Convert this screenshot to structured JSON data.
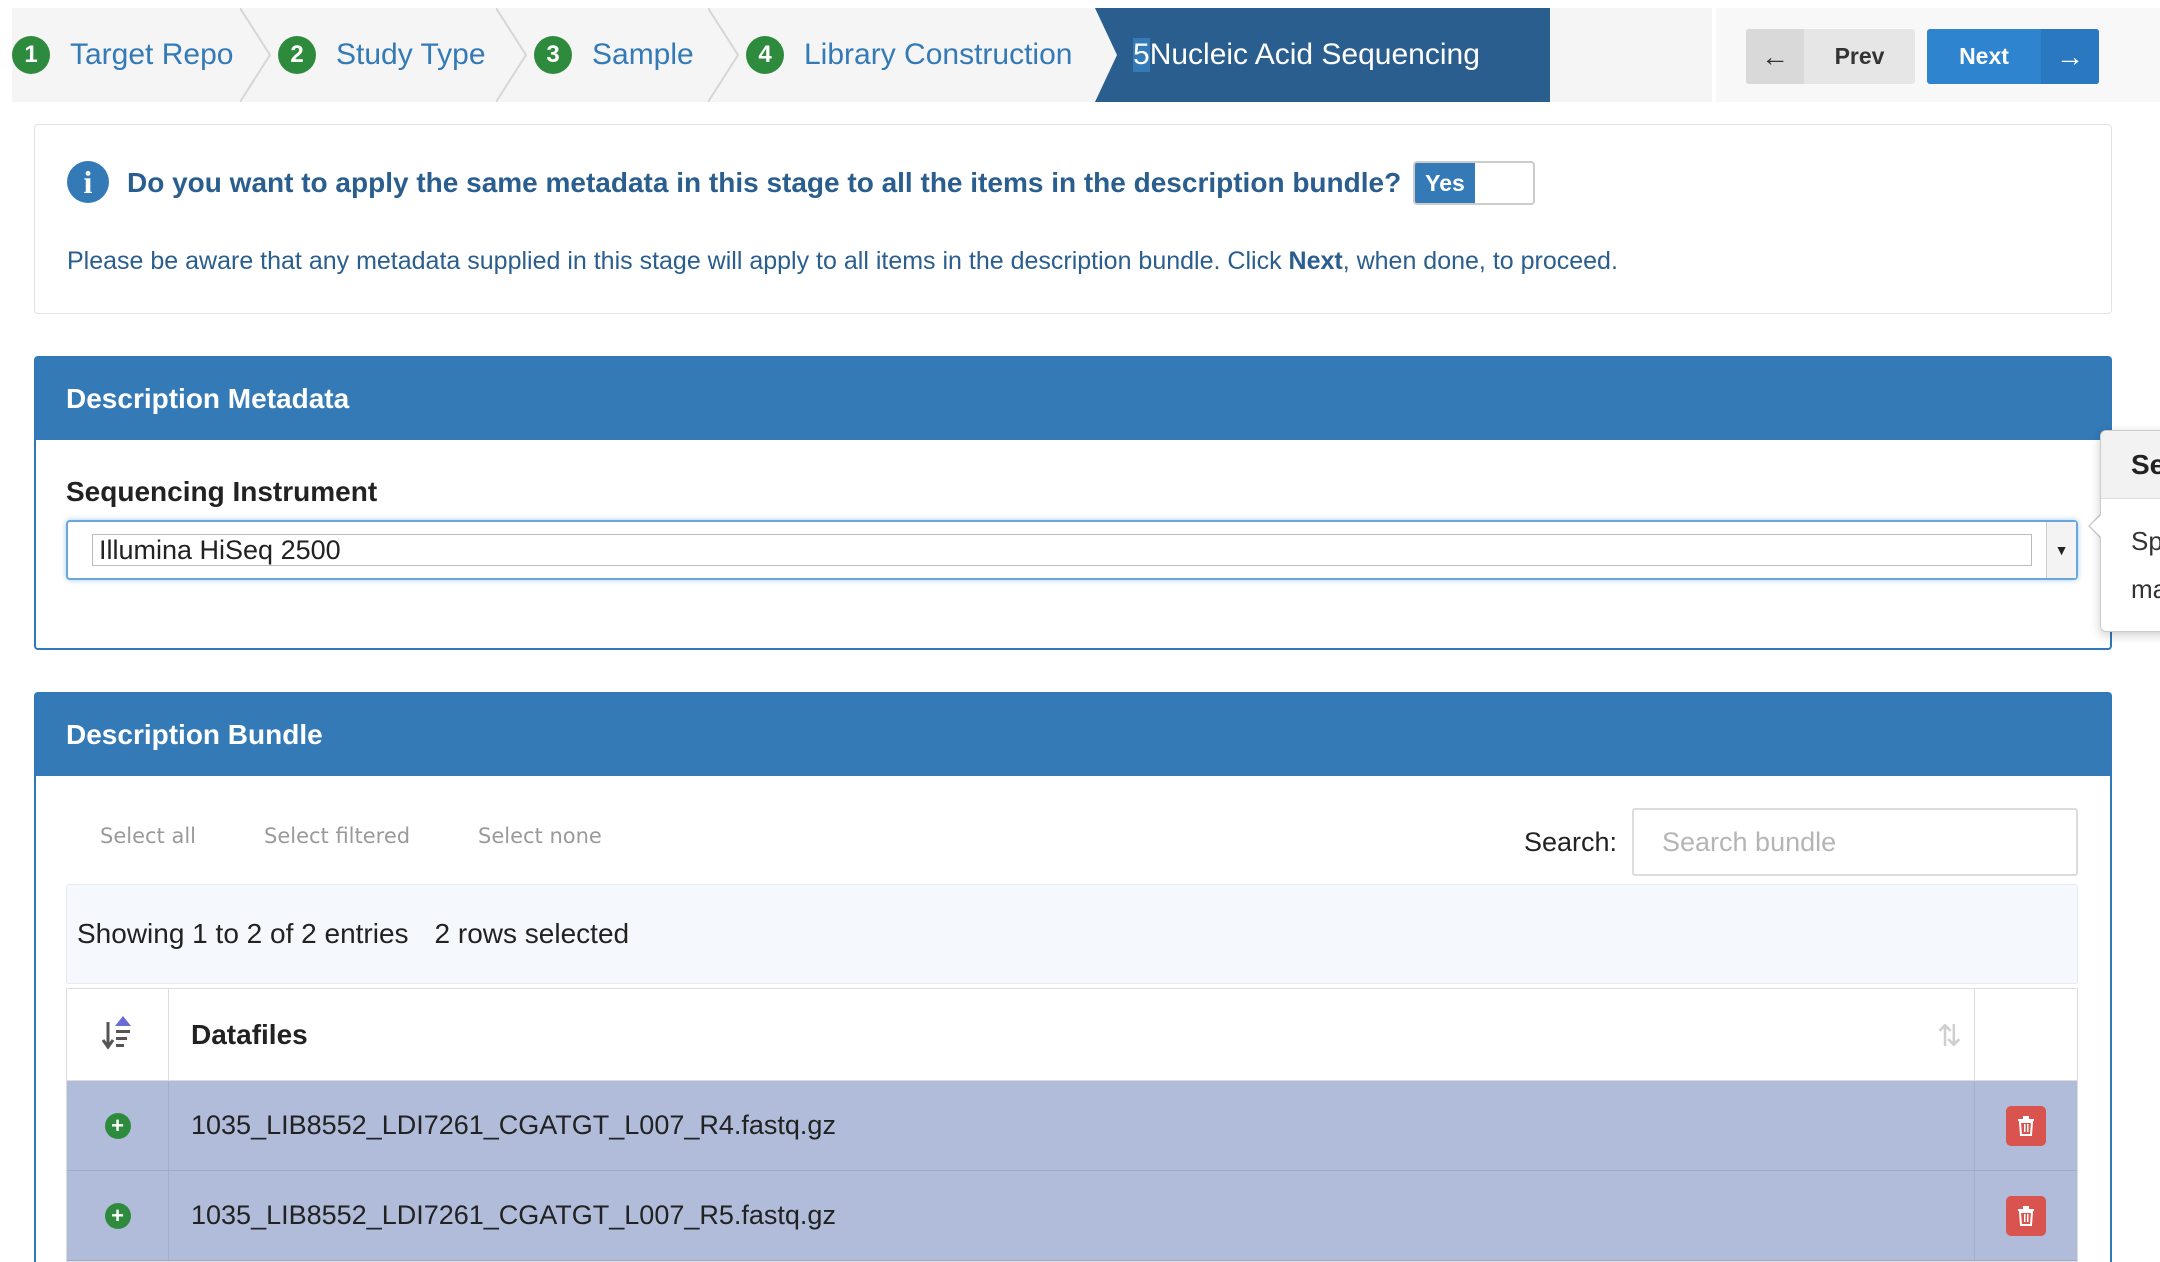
{
  "wizard": {
    "steps": [
      {
        "num": "1",
        "label": "Target Repo"
      },
      {
        "num": "2",
        "label": "Study Type"
      },
      {
        "num": "3",
        "label": "Sample"
      },
      {
        "num": "4",
        "label": "Library Construction"
      },
      {
        "num": "5",
        "label": "Nucleic Acid Sequencing",
        "active": true
      }
    ],
    "prev_label": "Prev",
    "next_label": "Next"
  },
  "info": {
    "question": "Do you want to apply the same metadata in this stage to all the items in the description bundle?",
    "toggle_label": "Yes",
    "note_prefix": "Please be aware that any metadata supplied in this stage will apply to all items in the description bundle. Click ",
    "note_bold": "Next",
    "note_suffix": ", when done, to proceed."
  },
  "metadata_panel": {
    "title": "Description Metadata",
    "field_label": "Sequencing Instrument",
    "field_value": "Illumina HiSeq 2500"
  },
  "popover": {
    "title": "Se",
    "lines": [
      "Sp",
      "ma"
    ]
  },
  "bundle_panel": {
    "title": "Description Bundle",
    "select_all": "Select all",
    "select_filtered": "Select filtered",
    "select_none": "Select none",
    "search_label": "Search:",
    "search_placeholder": "Search bundle",
    "showing": "Showing 1 to 2 of 2 entries",
    "selected": "2 rows selected",
    "column_header": "Datafiles",
    "rows": [
      "1035_LIB8552_LDI7261_CGATGT_L007_R4.fastq.gz",
      "1035_LIB8552_LDI7261_CGATGT_L007_R5.fastq.gz"
    ]
  },
  "colors": {
    "primary": "#337ab7",
    "active_step": "#2a5e8e",
    "step_number": "#2e8b3e",
    "selected_row": "#b0bcd9",
    "delete": "#d9534f"
  }
}
